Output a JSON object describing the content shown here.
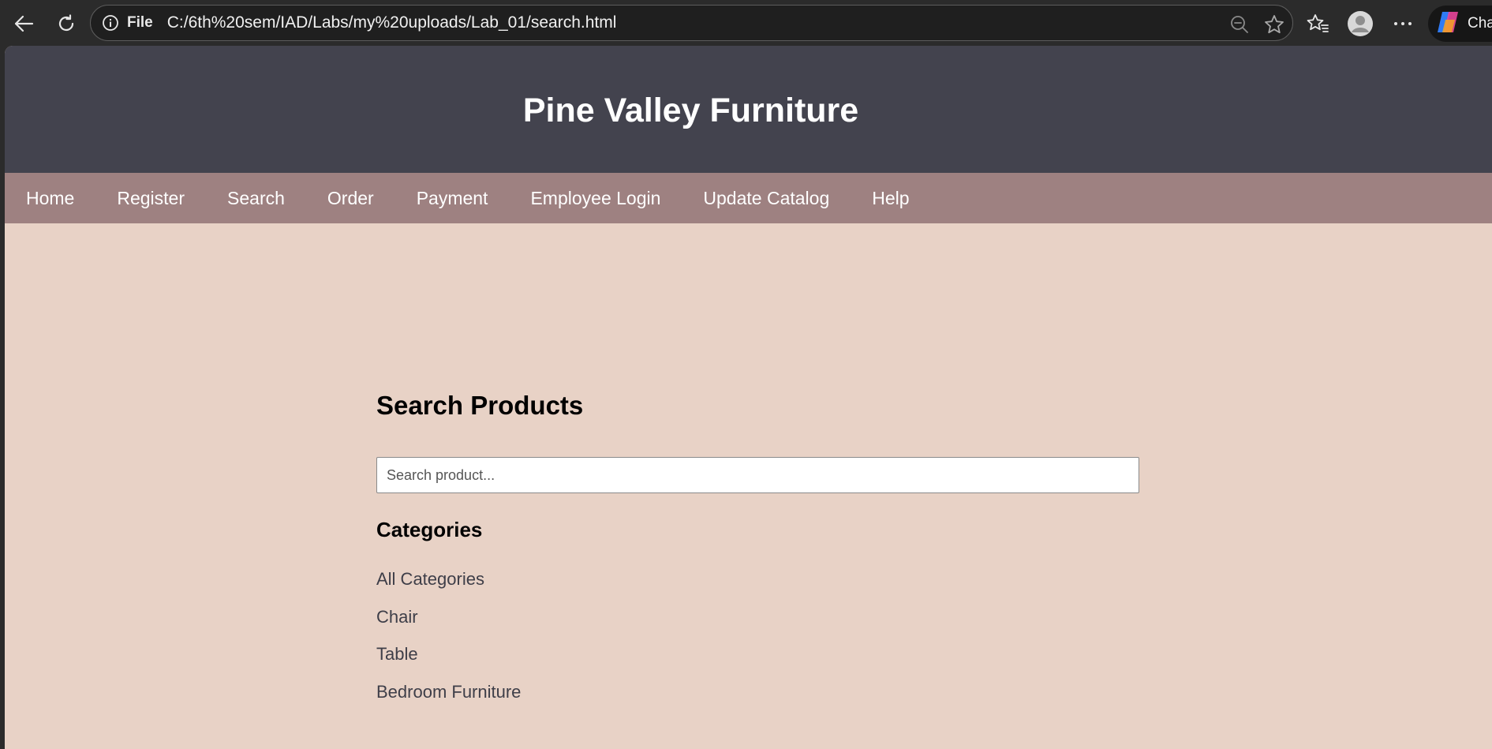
{
  "browser": {
    "file_label": "File",
    "url": "C:/6th%20sem/IAD/Labs/my%20uploads/Lab_01/search.html",
    "copilot_label": "Cha"
  },
  "icons": {
    "back": "back-arrow-icon",
    "refresh": "refresh-icon",
    "info": "info-icon",
    "zoom": "zoom-out-icon",
    "star": "star-icon",
    "favorites": "favorites-icon",
    "profile": "profile-icon",
    "more": "more-icon",
    "copilot": "copilot-icon"
  },
  "colors": {
    "header_bg": "#43434e",
    "nav_bg": "#9e8181",
    "page_bg": "#e8d2c6"
  },
  "header": {
    "title": "Pine Valley Furniture"
  },
  "nav": {
    "items": [
      {
        "label": "Home"
      },
      {
        "label": "Register"
      },
      {
        "label": "Search"
      },
      {
        "label": "Order"
      },
      {
        "label": "Payment"
      },
      {
        "label": "Employee Login"
      },
      {
        "label": "Update Catalog"
      },
      {
        "label": "Help"
      }
    ]
  },
  "main": {
    "title": "Search Products",
    "search": {
      "placeholder": "Search product...",
      "value": ""
    },
    "categories_title": "Categories",
    "categories": [
      {
        "label": "All Categories"
      },
      {
        "label": "Chair"
      },
      {
        "label": "Table"
      },
      {
        "label": "Bedroom Furniture"
      }
    ]
  }
}
